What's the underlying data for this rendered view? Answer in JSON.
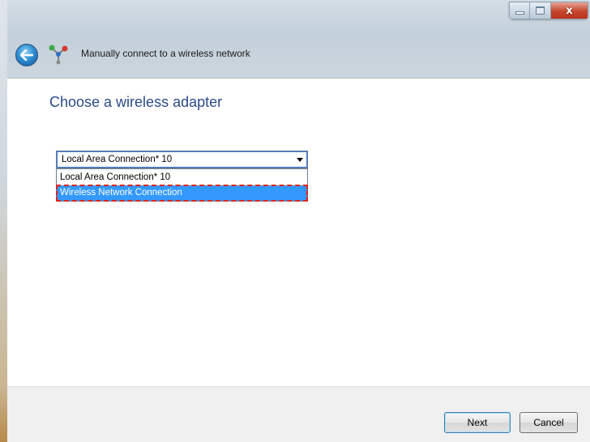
{
  "window": {
    "title": "Manually connect to a wireless network",
    "controls": {
      "minimize_icon": "minimize-icon",
      "maximize_icon": "maximize-icon",
      "close_icon": "close-icon",
      "close_glyph": "x"
    },
    "back_icon": "back-arrow-icon",
    "network_icon": "network-icon"
  },
  "main": {
    "heading": "Choose a wireless adapter",
    "adapter_select": {
      "selected_value": "Local Area Connection* 10",
      "options": [
        "Local Area Connection* 10",
        "Wireless Network Connection"
      ],
      "highlighted_option": "Wireless Network Connection"
    }
  },
  "footer": {
    "next_label": "Next",
    "cancel_label": "Cancel"
  },
  "colors": {
    "accent": "#3399ff",
    "heading": "#2c4a8c",
    "highlight_outline": "#e0241b"
  }
}
